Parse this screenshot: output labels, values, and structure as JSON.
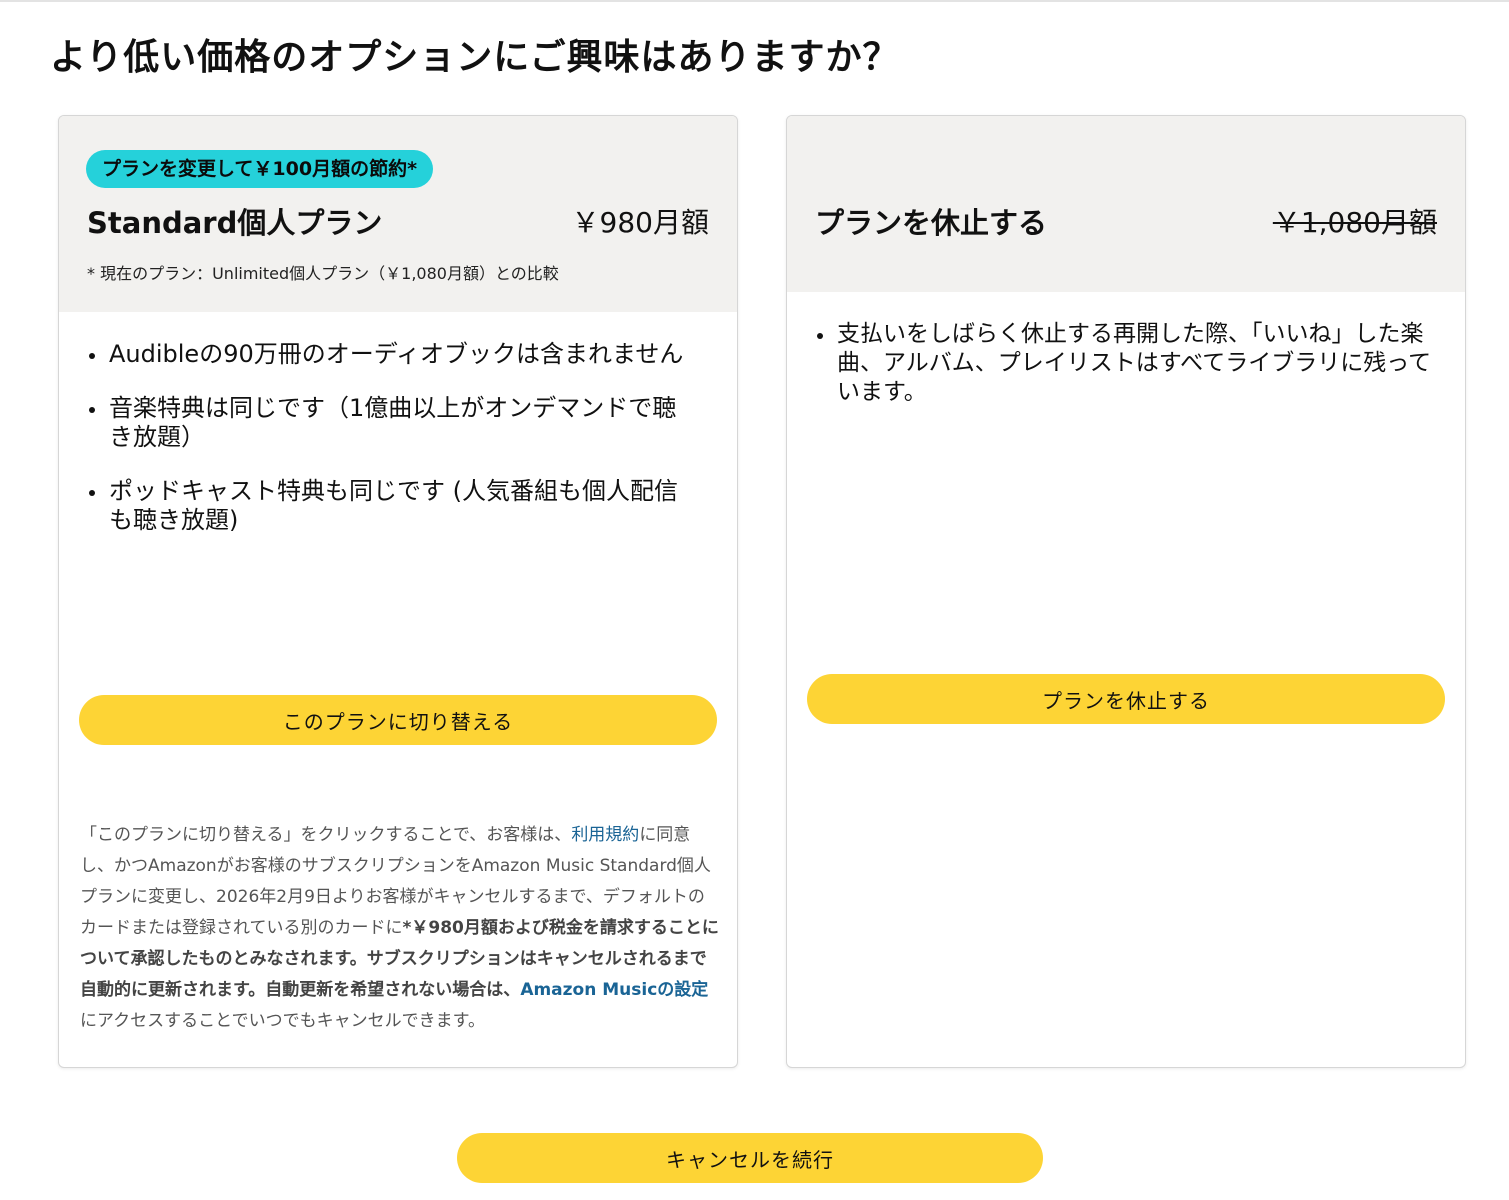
{
  "page": {
    "title": "より低い価格のオプションにご興味はありますか？"
  },
  "switch_card": {
    "badge": "プランを変更して￥100月額の節約*",
    "plan_name": "Standard個人プラン",
    "price": "￥980月額",
    "note": "* 現在のプラン：Unlimited個人プラン（￥1,080月額）との比較",
    "benefits": [
      "Audibleの90万冊のオーディオブックは含まれません",
      "音楽特典は同じです（1億曲以上がオンデマンドで聴き放題）",
      "ポッドキャスト特典も同じです (人気番組も個人配信も聴き放題)"
    ],
    "button_label": "このプランに切り替える",
    "legal": {
      "part1": "「このプランに切り替える」をクリックすることで、お客様は、",
      "terms_link": "利用規約",
      "part2": "に同意し、かつAmazonがお客様のサブスクリプションをAmazon Music Standard個人プランに変更し、2026年2月9日よりお客様がキャンセルするまで、デフォルトのカードまたは登録されている別のカードに",
      "bold": "*￥980月額および税金を請求することについて承認したものとみなされます。サブスクリプションはキャンセルされるまで自動的に更新されます。自動更新を希望されない場合は、",
      "settings_link": "Amazon Musicの設定",
      "part3": "にアクセスすることでいつでもキャンセルできます。"
    }
  },
  "pause_card": {
    "title": "プランを休止する",
    "price": "￥1,080月額",
    "benefits": [
      "支払いをしばらく休止する再開した際、「いいね」した楽曲、アルバム、プレイリストはすべてライブラリに残っています。"
    ],
    "button_label": "プランを休止する"
  },
  "footer": {
    "continue_label": "キャンセルを続行"
  },
  "colors": {
    "accent_button": "#fdd435",
    "badge": "#25d1da",
    "card_header": "#f2f1ef",
    "link": "#1a6495"
  }
}
